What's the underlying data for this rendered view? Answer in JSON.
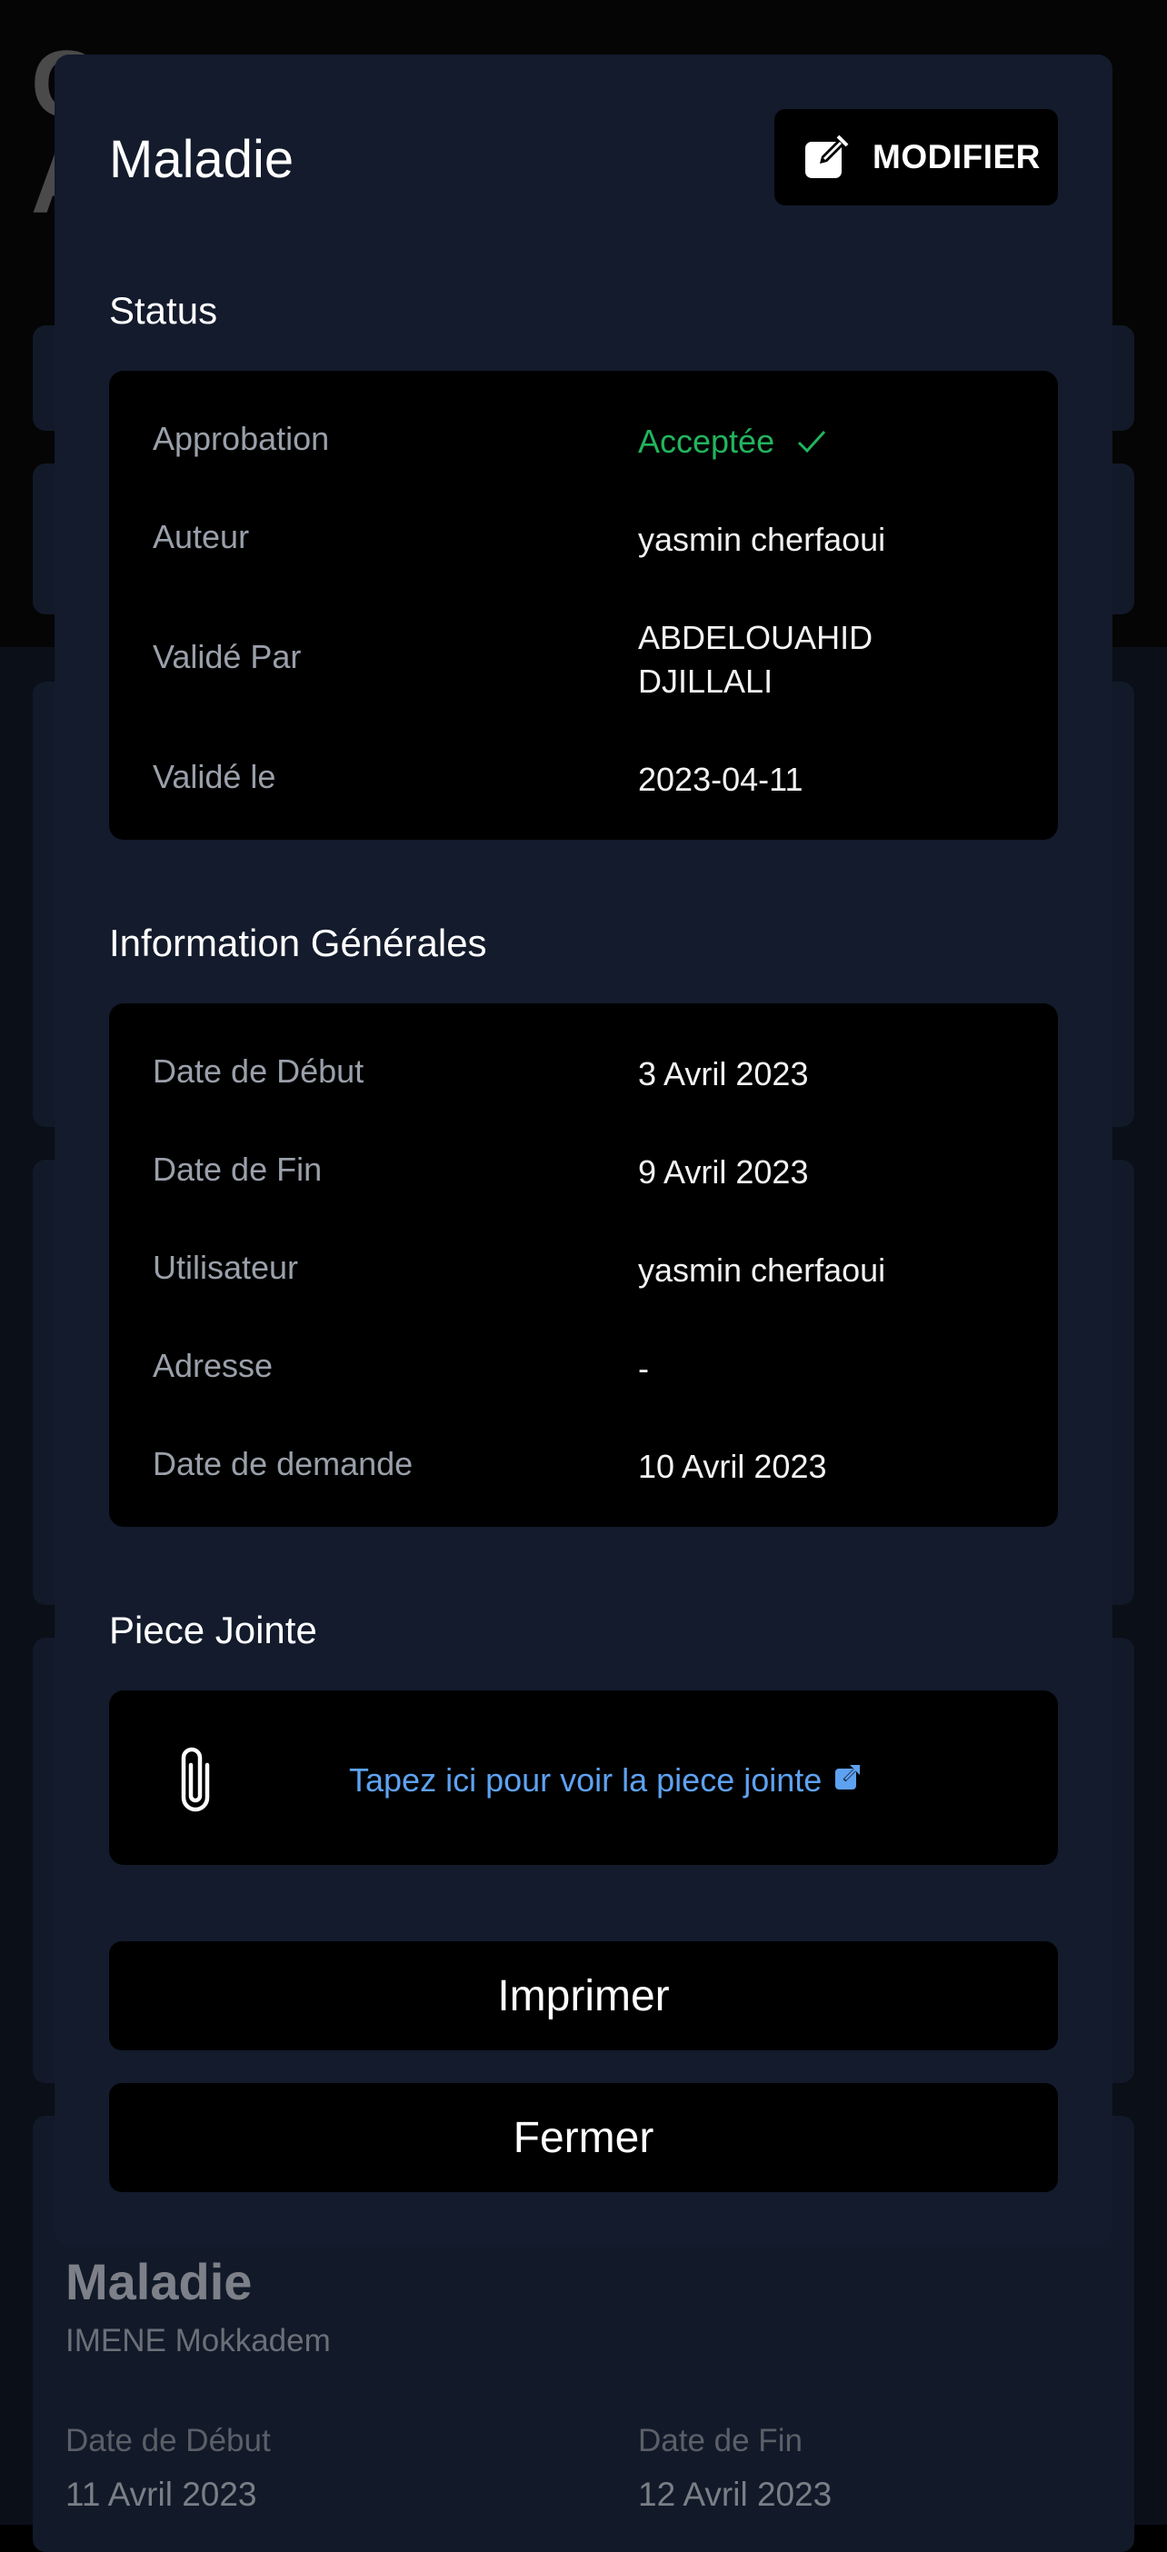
{
  "modal": {
    "title": "Maladie",
    "edit_label": "MODIFIER",
    "status": {
      "section_title": "Status",
      "rows": [
        {
          "key": "Approbation",
          "value": "Acceptée"
        },
        {
          "key": "Auteur",
          "value": "yasmin cherfaoui"
        },
        {
          "key": "Validé Par",
          "value": "ABDELOUAHID DJILLALI"
        },
        {
          "key": "Validé le",
          "value": "2023-04-11"
        }
      ]
    },
    "general": {
      "section_title": "Information Générales",
      "rows": [
        {
          "key": "Date de Début",
          "value": "3 Avril 2023"
        },
        {
          "key": "Date de Fin",
          "value": "9 Avril 2023"
        },
        {
          "key": "Utilisateur",
          "value": "yasmin cherfaoui"
        },
        {
          "key": "Adresse",
          "value": "-"
        },
        {
          "key": "Date de demande",
          "value": "10 Avril 2023"
        }
      ]
    },
    "attachment": {
      "section_title": "Piece Jointe",
      "link_text": "Tapez ici pour voir la piece jointe"
    },
    "print_label": "Imprimer",
    "close_label": "Fermer"
  },
  "background": {
    "heading_fragment": "C\nA",
    "card": {
      "title": "Maladie",
      "subtitle": "IMENE Mokkadem",
      "start_label": "Date de Début",
      "start_value": "11 Avril 2023",
      "end_label": "Date de Fin",
      "end_value": "12 Avril 2023"
    }
  },
  "colors": {
    "modal_bg": "#131b2c",
    "box_bg": "#000000",
    "accepted": "#22b45e",
    "link": "#5ea2f2"
  }
}
